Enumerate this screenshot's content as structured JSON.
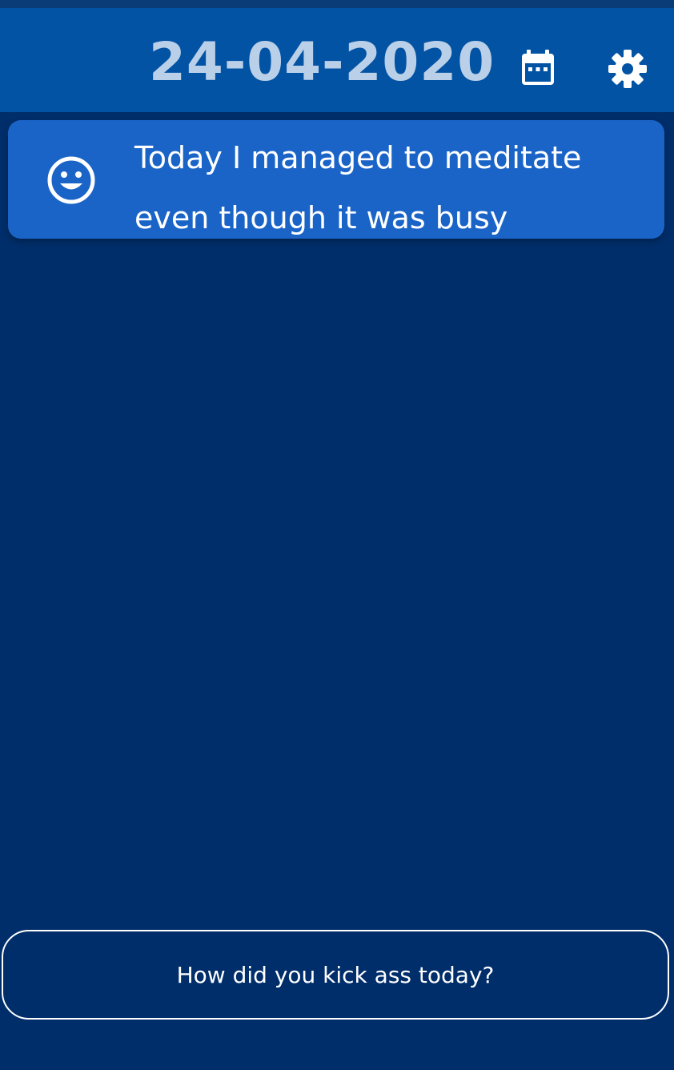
{
  "header": {
    "date": "24-04-2020",
    "calendar_icon": "calendar-icon",
    "settings_icon": "gear-icon"
  },
  "entries": [
    {
      "mood_icon": "smiley-face-icon",
      "text": "Today I managed to meditate even though it was busy"
    }
  ],
  "prompt": {
    "label": "How did you kick ass today?"
  },
  "colors": {
    "background": "#002e6a",
    "header": "#0353a4",
    "card": "#1a64c8",
    "date_text": "#b9d0e8",
    "text": "#ffffff"
  }
}
